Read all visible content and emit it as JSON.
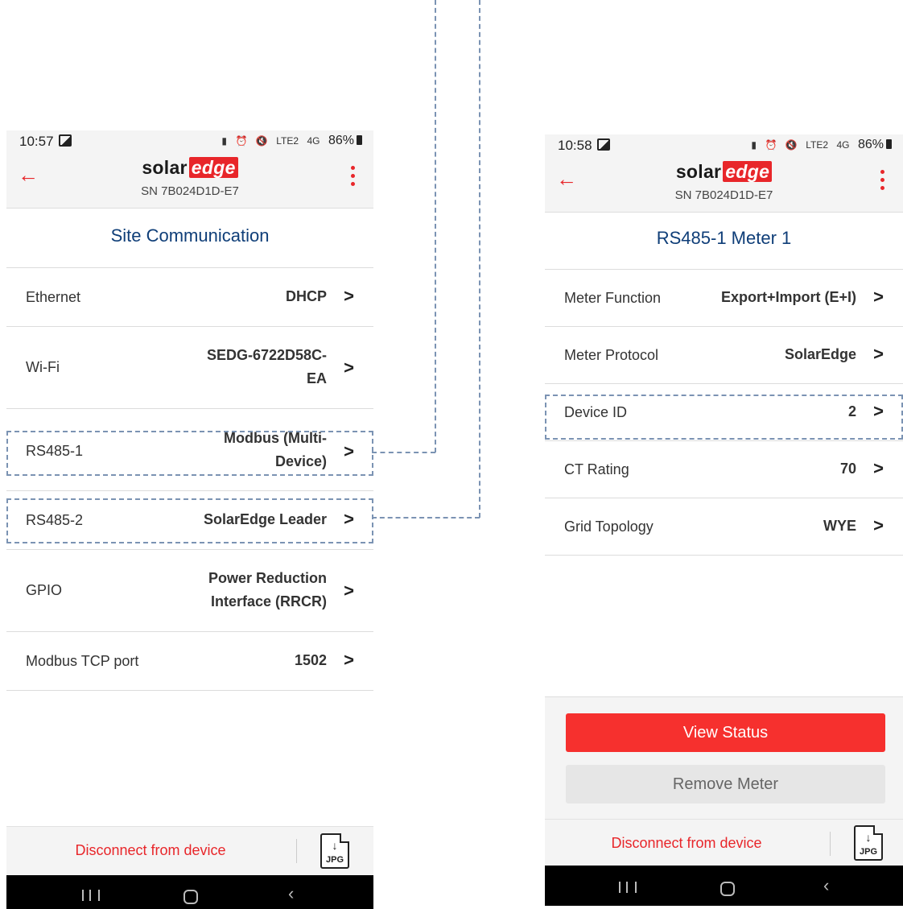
{
  "left_phone": {
    "status": {
      "time": "10:57",
      "signal_text": "LTE2",
      "network": "4G",
      "battery": "86%"
    },
    "header": {
      "brand_main": "solar",
      "brand_accent": "edge",
      "serial": "SN 7B024D1D-E7"
    },
    "title": "Site Communication",
    "rows": [
      {
        "label": "Ethernet",
        "value": "DHCP"
      },
      {
        "label": "Wi-Fi",
        "value_line1": "SEDG-6722D58C-",
        "value_line2": "EA"
      },
      {
        "label": "RS485-1",
        "value_line1": "Modbus (Multi-",
        "value_line2": "Device)"
      },
      {
        "label": "RS485-2",
        "value": "SolarEdge Leader"
      },
      {
        "label": "GPIO",
        "value_line1": "Power Reduction",
        "value_line2": "Interface (RRCR)"
      },
      {
        "label": "Modbus TCP port",
        "value": "1502"
      }
    ],
    "disconnect": "Disconnect from device",
    "jpg_label": "JPG"
  },
  "right_phone": {
    "status": {
      "time": "10:58",
      "signal_text": "LTE2",
      "network": "4G",
      "battery": "86%"
    },
    "header": {
      "brand_main": "solar",
      "brand_accent": "edge",
      "serial": "SN 7B024D1D-E7"
    },
    "title": "RS485-1 Meter 1",
    "rows": [
      {
        "label": "Meter Function",
        "value": "Export+Import (E+I)"
      },
      {
        "label": "Meter Protocol",
        "value": "SolarEdge"
      },
      {
        "label": "Device ID",
        "value": "2"
      },
      {
        "label": "CT Rating",
        "value": "70"
      },
      {
        "label": "Grid Topology",
        "value": "WYE"
      }
    ],
    "buttons": {
      "view_status": "View Status",
      "remove_meter": "Remove Meter"
    },
    "disconnect": "Disconnect from device",
    "jpg_label": "JPG"
  },
  "icons": {
    "back": "arrow-left-icon",
    "menu": "kebab-menu-icon",
    "chevron": "chevron-right-icon",
    "export": "jpg-export-icon"
  },
  "colors": {
    "brand_red": "#e8262a",
    "title_blue": "#0f3e78",
    "callout_dash": "#7b93b3"
  }
}
